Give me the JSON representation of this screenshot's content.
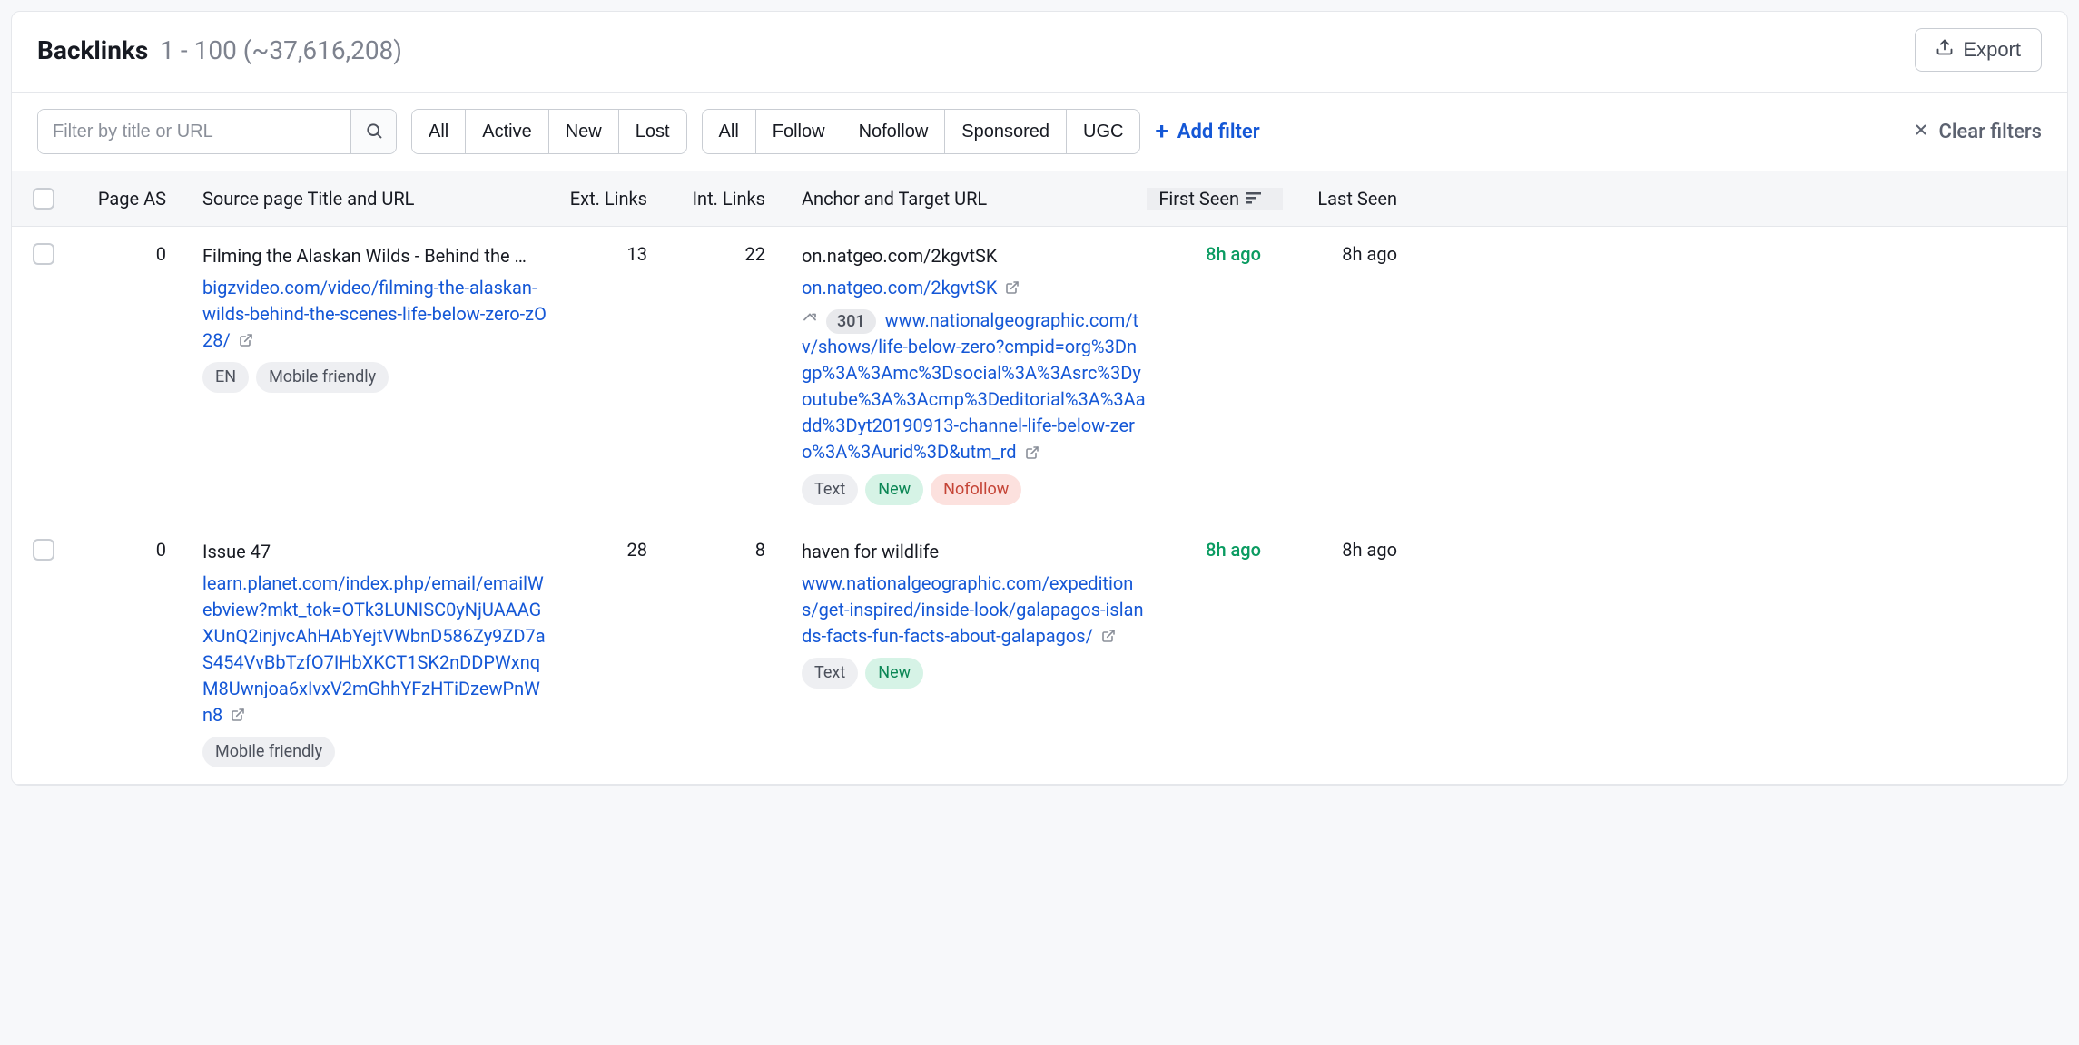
{
  "header": {
    "title": "Backlinks",
    "range": "1 - 100 (~37,616,208)",
    "export_label": "Export"
  },
  "toolbar": {
    "search_placeholder": "Filter by title or URL",
    "group1": [
      "All",
      "Active",
      "New",
      "Lost"
    ],
    "group2": [
      "All",
      "Follow",
      "Nofollow",
      "Sponsored",
      "UGC"
    ],
    "add_filter": "Add filter",
    "clear_filters": "Clear filters"
  },
  "columns": {
    "page_as": "Page AS",
    "source": "Source page Title and URL",
    "ext": "Ext. Links",
    "int": "Int. Links",
    "anchor": "Anchor and Target URL",
    "first_seen": "First Seen",
    "last_seen": "Last Seen"
  },
  "rows": [
    {
      "page_as": "0",
      "title": "Filming the Alaskan Wilds - Behind the …",
      "source_url": "bigzvideo.com/video/filming-the-alaskan-wilds-behind-the-scenes-life-below-zero-zO28/",
      "source_tags": [
        "EN",
        "Mobile friendly"
      ],
      "ext_links": "13",
      "int_links": "22",
      "anchor_text": "on.natgeo.com/2kgvtSK",
      "target_short": "on.natgeo.com/2kgvtSK",
      "redirect_code": "301",
      "redirect_url": "www.nationalgeographic.com/tv/shows/life-below-zero?cmpid=org%3Dngp%3A%3Amc%3Dsocial%3A%3Asrc%3Dyoutube%3A%3Acmp%3Deditorial%3A%3Aadd%3Dyt20190913-channel-life-below-zero%3A%3Aurid%3D&utm_rd",
      "anchor_tags": [
        {
          "label": "Text",
          "class": "pill-grey"
        },
        {
          "label": "New",
          "class": "pill-green"
        },
        {
          "label": "Nofollow",
          "class": "pill-red"
        }
      ],
      "first_seen": "8h ago",
      "last_seen": "8h ago"
    },
    {
      "page_as": "0",
      "title": "Issue 47",
      "source_url": "learn.planet.com/index.php/email/emailWebview?mkt_tok=OTk3LUNISC0yNjUAAAGXUnQ2injvcAhHAbYejtVWbnD586Zy9ZD7aS454VvBbTzfO7IHbXKCT1SK2nDDPWxnqM8Uwnjoa6xIvxV2mGhhYFzHTiDzewPnWn8",
      "source_tags": [
        "Mobile friendly"
      ],
      "ext_links": "28",
      "int_links": "8",
      "anchor_text": "haven for wildlife",
      "target_short": "www.nationalgeographic.com/expeditions/get-inspired/inside-look/galapagos-islands-facts-fun-facts-about-galapagos/",
      "redirect_code": "",
      "redirect_url": "",
      "anchor_tags": [
        {
          "label": "Text",
          "class": "pill-grey"
        },
        {
          "label": "New",
          "class": "pill-green"
        }
      ],
      "first_seen": "8h ago",
      "last_seen": "8h ago"
    }
  ]
}
